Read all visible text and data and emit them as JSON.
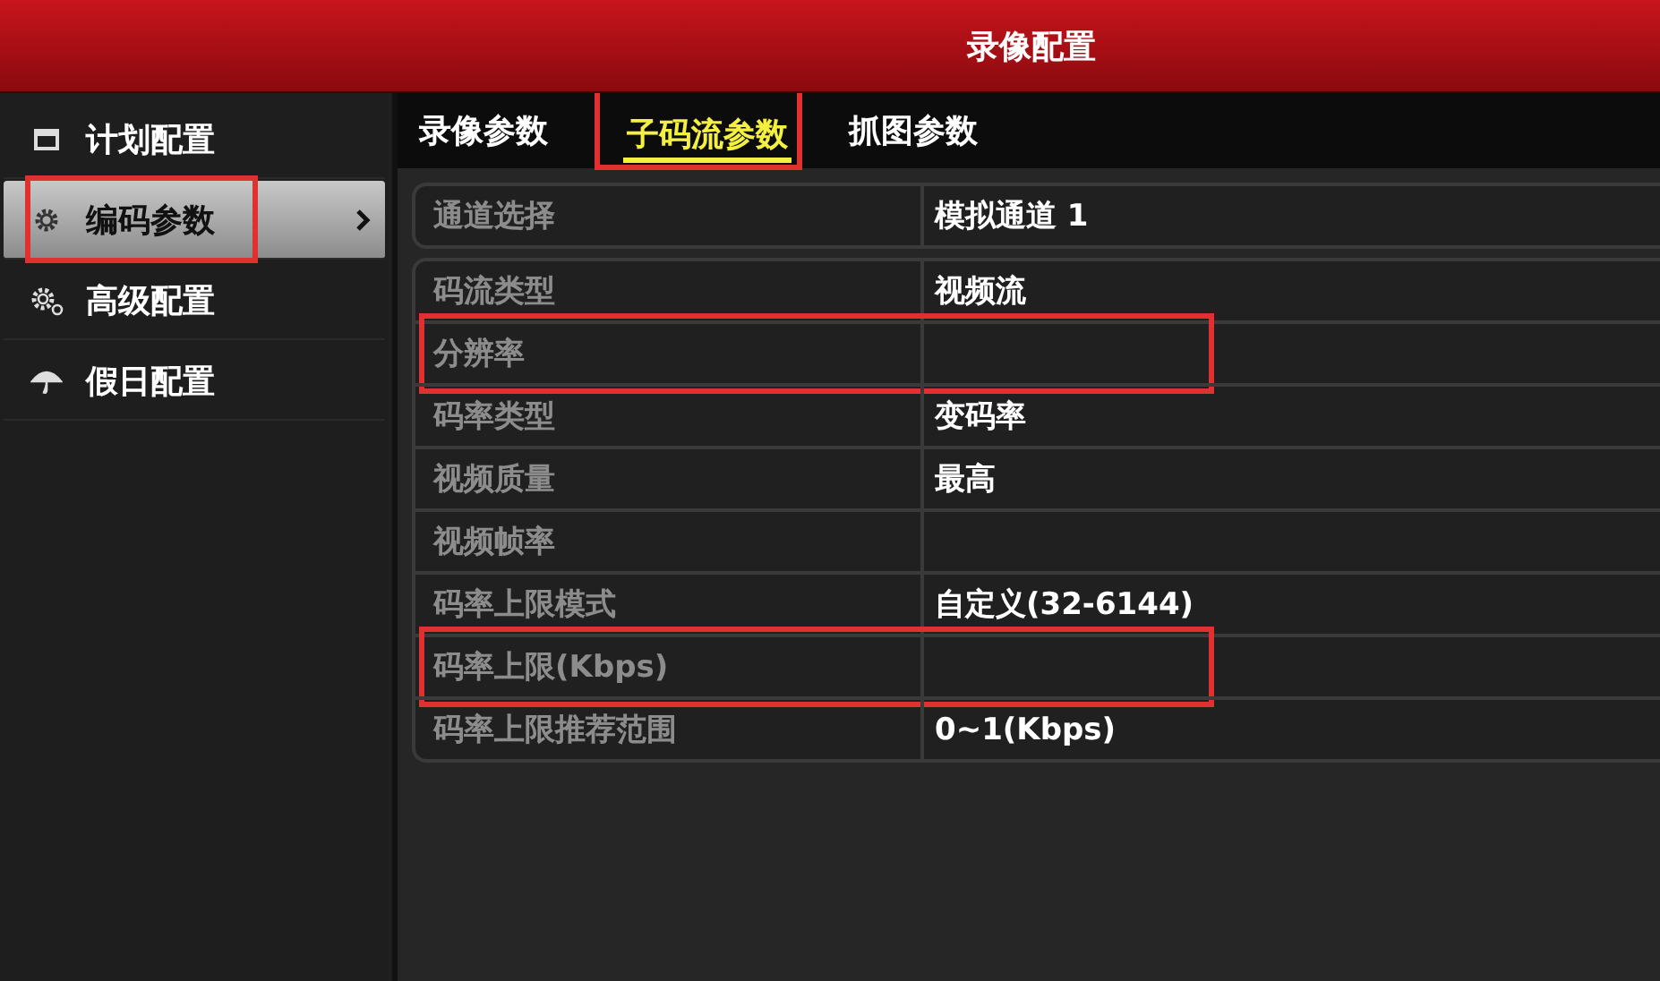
{
  "window": {
    "title": "录像配置"
  },
  "sidebar": {
    "items": [
      {
        "label": "计划配置",
        "selected": false,
        "highlighted": false
      },
      {
        "label": "编码参数",
        "selected": true,
        "highlighted": true
      },
      {
        "label": "高级配置",
        "selected": false,
        "highlighted": false
      },
      {
        "label": "假日配置",
        "selected": false,
        "highlighted": false
      }
    ]
  },
  "tabs": [
    {
      "label": "录像参数",
      "selected": false,
      "highlighted": false
    },
    {
      "label": "子码流参数",
      "selected": true,
      "highlighted": true
    },
    {
      "label": "抓图参数",
      "selected": false,
      "highlighted": false
    }
  ],
  "table": {
    "groups": [
      {
        "rows": [
          {
            "label": "通道选择",
            "value": "模拟通道 1",
            "highlighted": false
          }
        ]
      },
      {
        "rows": [
          {
            "label": "码流类型",
            "value": "视频流",
            "highlighted": false
          },
          {
            "label": "分辨率",
            "highlighted": true
          },
          {
            "label": "码率类型",
            "value": "变码率",
            "highlighted": false
          },
          {
            "label": "视频质量",
            "value": "最高",
            "highlighted": false
          },
          {
            "label": "视频帧率",
            "highlighted": false
          },
          {
            "label": "码率上限模式",
            "value": "自定义(32-6144)",
            "highlighted": false
          },
          {
            "label": "码率上限(Kbps)",
            "highlighted": true
          },
          {
            "label": "码率上限推荐范围",
            "value": "0~1(Kbps)",
            "highlighted": false
          }
        ]
      }
    ]
  }
}
